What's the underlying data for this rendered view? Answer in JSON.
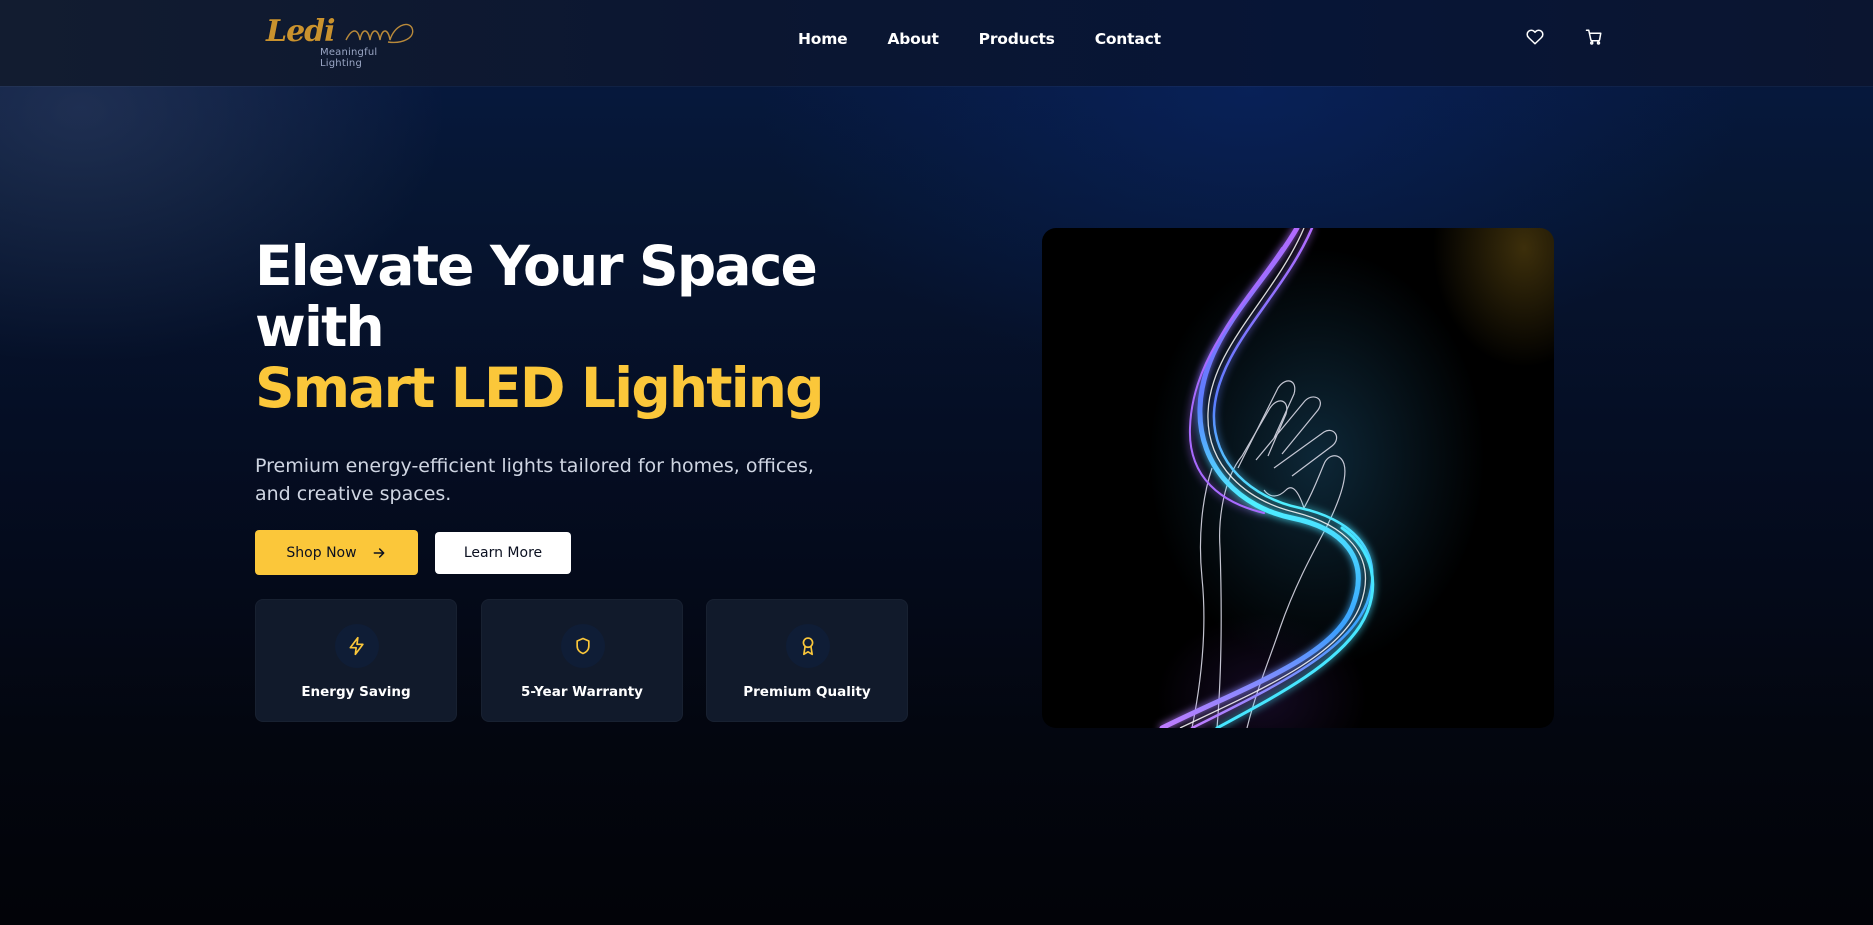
{
  "brand": {
    "logo_text": "Ledi",
    "tagline": "Meaningful Lighting",
    "logo_color": "#c9922e"
  },
  "nav": {
    "items": [
      {
        "label": "Home"
      },
      {
        "label": "About"
      },
      {
        "label": "Products"
      },
      {
        "label": "Contact"
      }
    ]
  },
  "header_icons": [
    "heart-icon",
    "cart-icon"
  ],
  "hero": {
    "title_line1": "Elevate Your Space",
    "title_line2": "with",
    "title_accent": "Smart LED Lighting",
    "subtitle": "Premium energy-efficient lights tailored for homes, offices, and creative spaces.",
    "primary_button": "Shop Now",
    "secondary_button": "Learn More",
    "image_icon": "glowing-hand-light-illustration"
  },
  "features": [
    {
      "label": "Energy Saving",
      "icon": "lightning-icon"
    },
    {
      "label": "5-Year Warranty",
      "icon": "shield-icon"
    },
    {
      "label": "Premium Quality",
      "icon": "award-icon"
    }
  ],
  "colors": {
    "accent": "#fbc73a",
    "background_dark": "#050a16",
    "card": "#111a2b"
  }
}
